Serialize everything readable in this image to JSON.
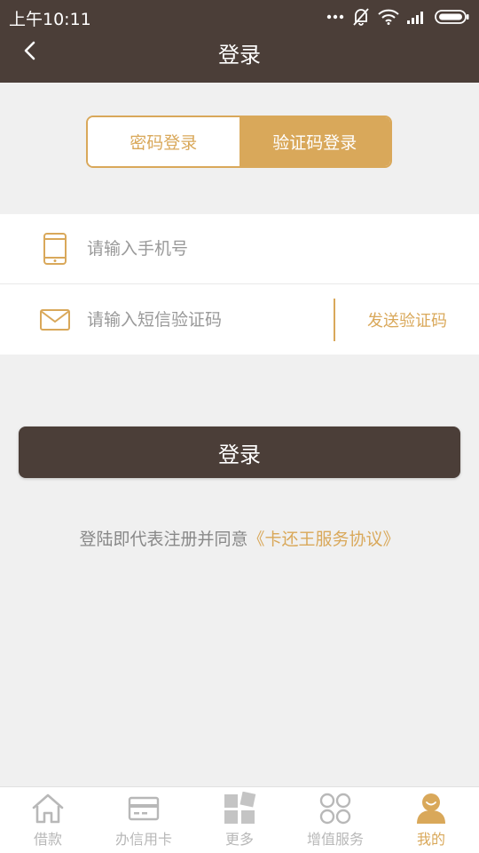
{
  "status_bar": {
    "time": "上午10:11",
    "icons": [
      "more-dots-icon",
      "bell-off-icon",
      "wifi-icon",
      "signal-icon",
      "battery-icon"
    ]
  },
  "header": {
    "title": "登录",
    "back_icon": "chevron-left-icon"
  },
  "login_tabs": {
    "password_label": "密码登录",
    "sms_label": "验证码登录",
    "active": "sms"
  },
  "form": {
    "phone_placeholder": "请输入手机号",
    "phone_value": "",
    "code_placeholder": "请输入短信验证码",
    "code_value": "",
    "send_code_label": "发送验证码",
    "phone_icon": "phone-icon",
    "mail_icon": "envelope-icon"
  },
  "login_button_label": "登录",
  "agreement": {
    "prefix": "登陆即代表注册并同意",
    "link": "《卡还王服务协议》"
  },
  "bottom_nav": {
    "items": [
      {
        "label": "借款",
        "icon": "home-icon"
      },
      {
        "label": "办信用卡",
        "icon": "credit-card-icon"
      },
      {
        "label": "更多",
        "icon": "grid-icon"
      },
      {
        "label": "增值服务",
        "icon": "clover-icon"
      },
      {
        "label": "我的",
        "icon": "user-icon"
      }
    ],
    "active_index": 4
  },
  "colors": {
    "header_bg": "#4b3e38",
    "accent": "#d9a85a",
    "page_bg": "#f0f0f0"
  }
}
